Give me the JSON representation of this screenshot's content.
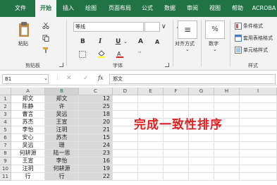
{
  "tabs": [
    "文件",
    "开始",
    "插入",
    "绘图",
    "页面布局",
    "公式",
    "数据",
    "审阅",
    "视图",
    "帮助",
    "ACROBA"
  ],
  "ribbon": {
    "clipboard": {
      "paste_label": "粘贴",
      "group_label": "剪贴板"
    },
    "font": {
      "font_name": "等线",
      "bold": "B",
      "italic": "I",
      "underline": "U",
      "grow": "A",
      "shrink": "A",
      "group_label": "字体",
      "phonetic": "ᵚ"
    },
    "alignment": {
      "label": "对齐方式"
    },
    "number": {
      "label": "数字",
      "percent": "%"
    },
    "styles": {
      "conditional_format": "条件格式",
      "table_format": "套用表格格式",
      "cell_styles": "单元格样式",
      "group_label": "样式"
    }
  },
  "formula_bar": {
    "name_box": "B1",
    "fx": "fx",
    "content": "郑文"
  },
  "columns": [
    "A",
    "B",
    "C",
    "D",
    "E",
    "F",
    "G",
    "H",
    "I"
  ],
  "rows": [
    {
      "n": "1",
      "a": "郑文",
      "b": "郑文",
      "c": "12"
    },
    {
      "n": "2",
      "a": "陈静",
      "b": "许",
      "c": "25"
    },
    {
      "n": "3",
      "a": "曹言",
      "b": "吴远",
      "c": "18"
    },
    {
      "n": "4",
      "a": "苏杰",
      "b": "王宣",
      "c": "20"
    },
    {
      "n": "5",
      "a": "李怡",
      "b": "汪玥",
      "c": "21"
    },
    {
      "n": "6",
      "a": "安心",
      "b": "苏杰",
      "c": "15"
    },
    {
      "n": "7",
      "a": "吴远",
      "b": "珊",
      "c": "24"
    },
    {
      "n": "8",
      "a": "何耕源",
      "b": "陆一思",
      "c": "23"
    },
    {
      "n": "9",
      "a": "王宣",
      "b": "李怡",
      "c": "16"
    },
    {
      "n": "10",
      "a": "汪玥",
      "b": "何耕源",
      "c": "19"
    },
    {
      "n": "11",
      "a": "行",
      "b": "行",
      "c": "22"
    }
  ],
  "overlay_text": "完成一致性排序",
  "colors": {
    "excel_green": "#217346",
    "overlay_red": "#e02020",
    "selection_gray": "#d9d9d9"
  }
}
